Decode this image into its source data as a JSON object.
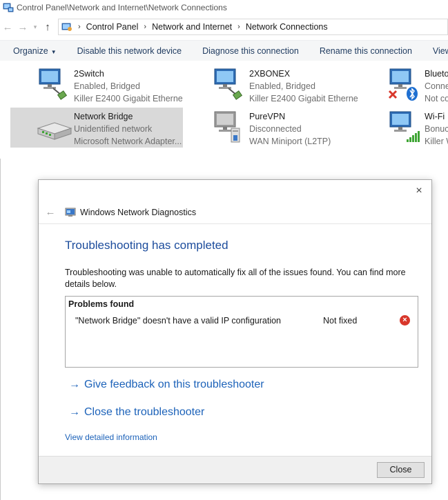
{
  "window": {
    "title": "Control Panel\\Network and Internet\\Network Connections"
  },
  "address": {
    "crumbs": [
      "Control Panel",
      "Network and Internet",
      "Network Connections"
    ]
  },
  "toolbar": {
    "organize": "Organize",
    "disable": "Disable this network device",
    "diagnose": "Diagnose this connection",
    "rename": "Rename this connection",
    "view_status": "View stat"
  },
  "connections": [
    {
      "name": "2Switch",
      "status": "Enabled, Bridged",
      "device": "Killer E2400 Gigabit Etherne..."
    },
    {
      "name": "2XBONEX",
      "status": "Enabled, Bridged",
      "device": "Killer E2400 Gigabit Etherne..."
    },
    {
      "name": "Blueto",
      "status": "Conne",
      "device": "Not co"
    },
    {
      "name": "Network Bridge",
      "status": "Unidentified network",
      "device": "Microsoft Network Adapter..."
    },
    {
      "name": "PureVPN",
      "status": "Disconnected",
      "device": "WAN Miniport (L2TP)"
    },
    {
      "name": "Wi-Fi",
      "status": "Bonucl",
      "device": "Killer W"
    }
  ],
  "dialog": {
    "title": "Windows Network Diagnostics",
    "heading": "Troubleshooting has completed",
    "message": "Troubleshooting was unable to automatically fix all of the issues found. You can find more details below.",
    "problems_header": "Problems found",
    "issue": "\"Network Bridge\" doesn't have a valid IP configuration",
    "issue_status": "Not fixed",
    "feedback_arrow": "→",
    "feedback_link": "Give feedback on this troubleshooter",
    "close_arrow": "→",
    "close_link": "Close the troubleshooter",
    "details_link": "View detailed information",
    "close_button": "Close",
    "close_glyph": "×",
    "back_glyph": "←",
    "error_glyph": "×"
  },
  "colors": {
    "heading_blue": "#1c4c9c",
    "link_blue": "#1c62b9",
    "error_red": "#d8372b",
    "selection_gray": "#d9d9d9"
  }
}
